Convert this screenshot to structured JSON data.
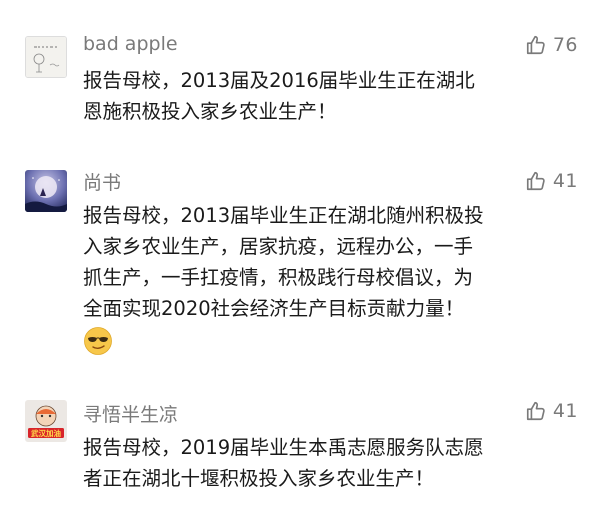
{
  "comments": [
    {
      "username": "bad apple",
      "likes": "76",
      "lines": [
        "报告母校，2013届及2016届毕业生正在湖北",
        "恩施积极投入家乡农业生产！"
      ],
      "avatar": "sketch-avatar"
    },
    {
      "username": "尚书",
      "likes": "41",
      "lines": [
        "报告母校，2013届毕业生正在湖北随州积极投",
        "入家乡农业生产，居家抗疫，远程办公，一手",
        "抓生产，一手扛疫情，积极践行母校倡议，为",
        "全面实现2020社会经济生产目标贡献力量！"
      ],
      "avatar": "moon-night-avatar",
      "emoji": "sunglasses-smirk-emoji"
    },
    {
      "username": "寻悟半生凉",
      "likes": "41",
      "lines": [
        "报告母校，2019届毕业生本禹志愿服务队志愿",
        "者正在湖北十堰积极投入家乡农业生产！"
      ],
      "avatar": "wuhan-cheer-avatar",
      "avatar_text": "武汉加油"
    }
  ],
  "colors": {
    "meta_gray": "#7a7a7a",
    "text": "#1a1a1a",
    "background": "#ffffff"
  },
  "icons": {
    "like": "thumbs-up-icon"
  }
}
